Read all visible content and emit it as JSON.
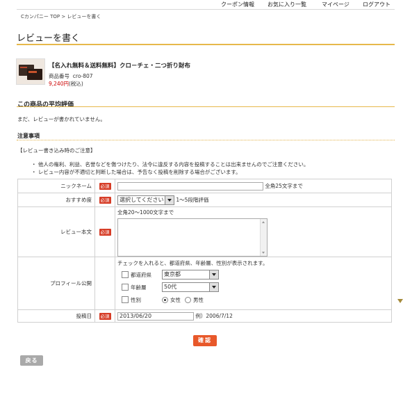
{
  "topnav": {
    "coupon": "クーポン情報",
    "favorites": "お気に入り一覧",
    "mypage": "マイページ",
    "logout": "ログアウト"
  },
  "breadcrumb": "Cカンパニー TOP > レビューを書く",
  "page_title": "レビューを書く",
  "product": {
    "name": "【名入れ無料＆送料無料】クロ－チェ・二つ折り財布",
    "code_label": "商品番号",
    "code": "cro-807",
    "price": "9,240円",
    "tax": "(税込)"
  },
  "average_section": {
    "title": "この商品の平均評価",
    "no_reviews": "まだ、レビューが書かれていません。"
  },
  "notes": {
    "title": "注意事項",
    "heading": "【レビュー書き込み時のご注意】",
    "items": [
      "・ 他人の権利、利益、名誉などを傷つけたり、法令に違反する内容を投稿することは出来ませんのでご注意ください。",
      "・ レビュー内容が不適切と判断した場合は、予告なく投稿を削除する場合がございます。"
    ]
  },
  "form": {
    "required_badge": "必須",
    "nickname": {
      "label": "ニックネーム",
      "value": "",
      "hint": "全角25文字まで"
    },
    "recommend": {
      "label": "おすすめ度",
      "selected": "選択してください",
      "hint": "1～5段階評価"
    },
    "review": {
      "label": "レビュー本文",
      "hint": "全角20～1000文字まで",
      "value": ""
    },
    "profile": {
      "label": "プロフィール公開",
      "hint": "チェックを入れると、都道府県、年齢層、性別が表示されます。",
      "prefecture_label": "都道府県",
      "prefecture_value": "東京都",
      "age_label": "年齢層",
      "age_value": "50代",
      "gender_label": "性別",
      "female": "女性",
      "male": "男性"
    },
    "date": {
      "label": "投稿日",
      "value": "2013/06/20",
      "example": "例）2006/7/12"
    }
  },
  "buttons": {
    "confirm": "確認",
    "back": "戻る"
  }
}
